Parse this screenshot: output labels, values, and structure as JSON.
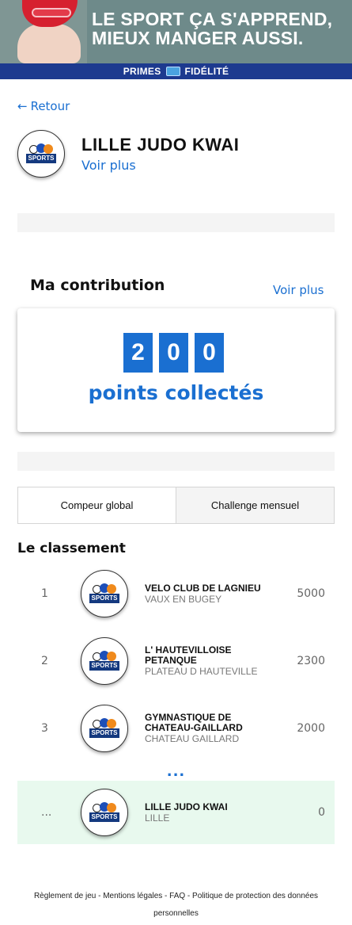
{
  "banner": {
    "headline_line1": "LE SPORT ÇA S'APPREND,",
    "headline_line2": "MIEUX MANGER AUSSI.",
    "brand_left": "PRIMES",
    "brand_right": "FIDÉLITÉ"
  },
  "nav": {
    "back_label": "Retour",
    "back_icon": "←"
  },
  "club": {
    "name": "LILLE JUDO KWAI",
    "more_label": "Voir plus",
    "logo_text": "SPORTS"
  },
  "contribution": {
    "title": "Ma contribution",
    "more_label": "Voir plus",
    "digits": [
      "2",
      "0",
      "0"
    ],
    "points_label": "points collectés"
  },
  "tabs": [
    {
      "label": "Compeur global"
    },
    {
      "label": "Challenge mensuel"
    }
  ],
  "ranking": {
    "title": "Le classement",
    "rows": [
      {
        "rank": "1",
        "name": "VELO CLUB DE LAGNIEU",
        "city": "VAUX EN BUGEY",
        "score": "5000"
      },
      {
        "rank": "2",
        "name": "L' HAUTEVILLOISE PETANQUE",
        "city": "PLATEAU D HAUTEVILLE",
        "score": "2300"
      },
      {
        "rank": "3",
        "name": "GYMNASTIQUE DE CHATEAU-GAILLARD",
        "city": "CHATEAU GAILLARD",
        "score": "2000"
      }
    ],
    "ellipsis": "...",
    "mine": {
      "rank": "...",
      "name": "LILLE JUDO KWAI",
      "city": "LILLE",
      "score": "0"
    }
  },
  "footer": {
    "text": "Règlement de jeu - Mentions légales - FAQ - Politique de protection des données personnelles"
  },
  "colors": {
    "accent": "#1a6fd1",
    "highlight_row": "#e8f9ee",
    "banner_bar": "#1d3a8f"
  }
}
